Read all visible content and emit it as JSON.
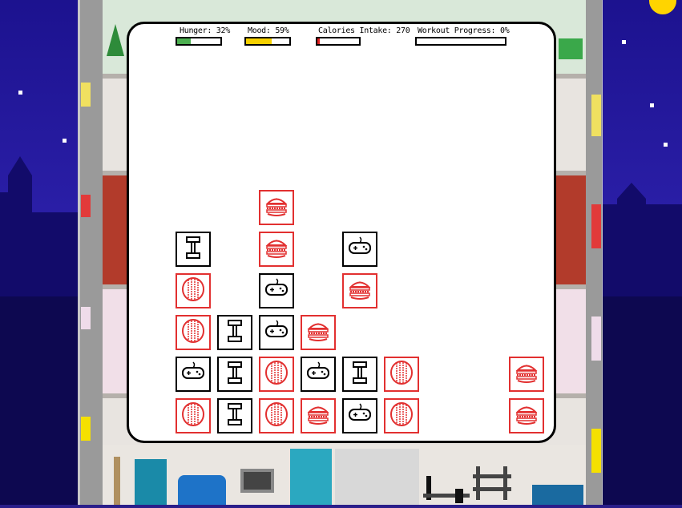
{
  "stats": {
    "hunger": {
      "label": "Hunger: 32%",
      "value": 0.32,
      "color": "#4caf50"
    },
    "mood": {
      "label": "Mood: 59%",
      "value": 0.59,
      "color": "#f5d000"
    },
    "calories": {
      "label": "Calories Intake: 270",
      "value": 0.06,
      "color": "#e02020"
    },
    "workout": {
      "label": "Workout Progress: 0%",
      "value": 0.0,
      "color": "#3a6fe0"
    }
  },
  "board": {
    "tiles": [
      {
        "icon": "burger-icon",
        "color": "red"
      },
      {
        "icon": "dumbbell-icon",
        "color": "black"
      },
      {
        "icon": "burger-icon",
        "color": "red"
      },
      {
        "icon": "gamepad-icon",
        "color": "black"
      },
      {
        "icon": "donut-icon",
        "color": "red"
      },
      {
        "icon": "gamepad-icon",
        "color": "black"
      },
      {
        "icon": "burger-icon",
        "color": "red"
      },
      {
        "icon": "donut-icon",
        "color": "red"
      },
      {
        "icon": "dumbbell-icon",
        "color": "black"
      },
      {
        "icon": "gamepad-icon",
        "color": "black"
      },
      {
        "icon": "burger-icon",
        "color": "red"
      },
      {
        "icon": "gamepad-icon",
        "color": "black"
      },
      {
        "icon": "dumbbell-icon",
        "color": "black"
      },
      {
        "icon": "donut-icon",
        "color": "red"
      },
      {
        "icon": "gamepad-icon",
        "color": "black"
      },
      {
        "icon": "dumbbell-icon",
        "color": "black"
      },
      {
        "icon": "donut-icon",
        "color": "red"
      },
      {
        "icon": "burger-icon",
        "color": "red"
      },
      {
        "icon": "donut-icon",
        "color": "red"
      },
      {
        "icon": "dumbbell-icon",
        "color": "black"
      },
      {
        "icon": "donut-icon",
        "color": "red"
      },
      {
        "icon": "burger-icon",
        "color": "red"
      },
      {
        "icon": "gamepad-icon",
        "color": "black"
      },
      {
        "icon": "donut-icon",
        "color": "red"
      },
      {
        "icon": "burger-icon",
        "color": "red"
      }
    ]
  }
}
